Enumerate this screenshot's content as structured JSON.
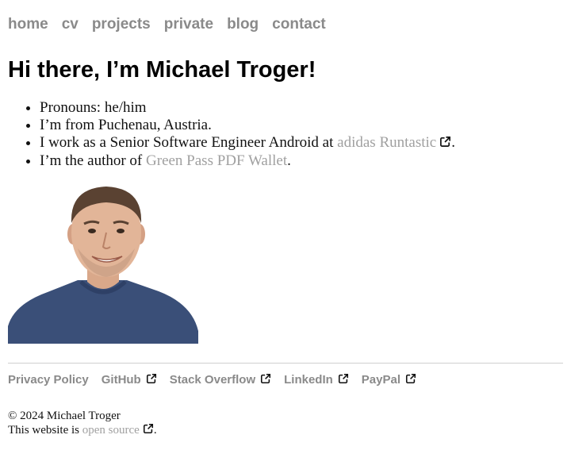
{
  "nav": {
    "items": [
      {
        "label": "home"
      },
      {
        "label": "cv"
      },
      {
        "label": "projects"
      },
      {
        "label": "private"
      },
      {
        "label": "blog"
      },
      {
        "label": "contact"
      }
    ]
  },
  "main": {
    "title": "Hi there, I’m Michael Troger!",
    "facts": {
      "pronouns": "Pronouns: he/him",
      "from": "I’m from Puchenau, Austria.",
      "work_prefix": "I work as a Senior Software Engineer Android at ",
      "work_link": "adidas Runtastic",
      "work_suffix": ".",
      "author_prefix": "I’m the author of ",
      "author_link": "Green Pass PDF Wallet",
      "author_suffix": "."
    },
    "photo_icon": "portrait-photo"
  },
  "footer": {
    "links": [
      {
        "label": "Privacy Policy",
        "external": false
      },
      {
        "label": "GitHub",
        "external": true
      },
      {
        "label": "Stack Overflow",
        "external": true
      },
      {
        "label": "LinkedIn",
        "external": true
      },
      {
        "label": "PayPal",
        "external": true
      }
    ],
    "copyright": "© 2024 Michael Troger",
    "source_prefix": "This website is ",
    "source_link": "open source",
    "source_suffix": "."
  },
  "colors": {
    "link": "#8a8a8a",
    "inline_link": "#a0a0a0",
    "shirt": "#3a4f78",
    "divider": "#cfcfcf"
  }
}
